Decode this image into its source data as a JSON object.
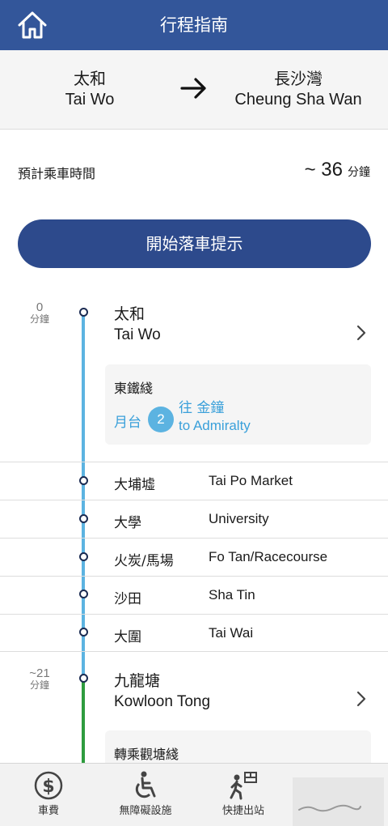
{
  "header": {
    "title": "行程指南",
    "home_icon": "home-icon"
  },
  "route": {
    "from": {
      "zh": "太和",
      "en": "Tai Wo"
    },
    "to": {
      "zh": "長沙灣",
      "en": "Cheung Sha Wan"
    },
    "arrow_icon": "arrow-right-icon"
  },
  "journey": {
    "label": "預計乘車時間",
    "value": "~ 36",
    "unit": "分鐘"
  },
  "alert_button": {
    "label": "開始落車提示"
  },
  "timeline": {
    "start": {
      "mins": "0",
      "mins_unit": "分鐘",
      "zh": "太和",
      "en": "Tai Wo",
      "line_name": "東鐵綫",
      "platform_label": "月台",
      "platform_no": "2",
      "towards_zh": "往 金鐘",
      "towards_en": "to Admiralty"
    },
    "stops": [
      {
        "zh": "大埔墟",
        "en": "Tai Po Market"
      },
      {
        "zh": "大學",
        "en": "University"
      },
      {
        "zh": "火炭/馬場",
        "en": "Fo Tan/Racecourse"
      },
      {
        "zh": "沙田",
        "en": "Sha Tin"
      },
      {
        "zh": "大圍",
        "en": "Tai Wai"
      }
    ],
    "interchange": {
      "mins": "~21",
      "mins_unit": "分鐘",
      "zh": "九龍塘",
      "en": "Kowloon Tong",
      "transfer_label": "轉乘觀塘綫"
    },
    "colors": {
      "east_rail": "#5cb3e1",
      "kwun_tong": "#2e9c3e"
    }
  },
  "bottom_nav": [
    {
      "label": "車費",
      "icon": "fare-dollar-icon"
    },
    {
      "label": "無障礙設施",
      "icon": "wheelchair-icon"
    },
    {
      "label": "快捷出站",
      "icon": "exit-walking-icon"
    }
  ],
  "colors": {
    "header": "#33569a",
    "button": "#2d4a8c",
    "accent": "#3aa0da"
  }
}
